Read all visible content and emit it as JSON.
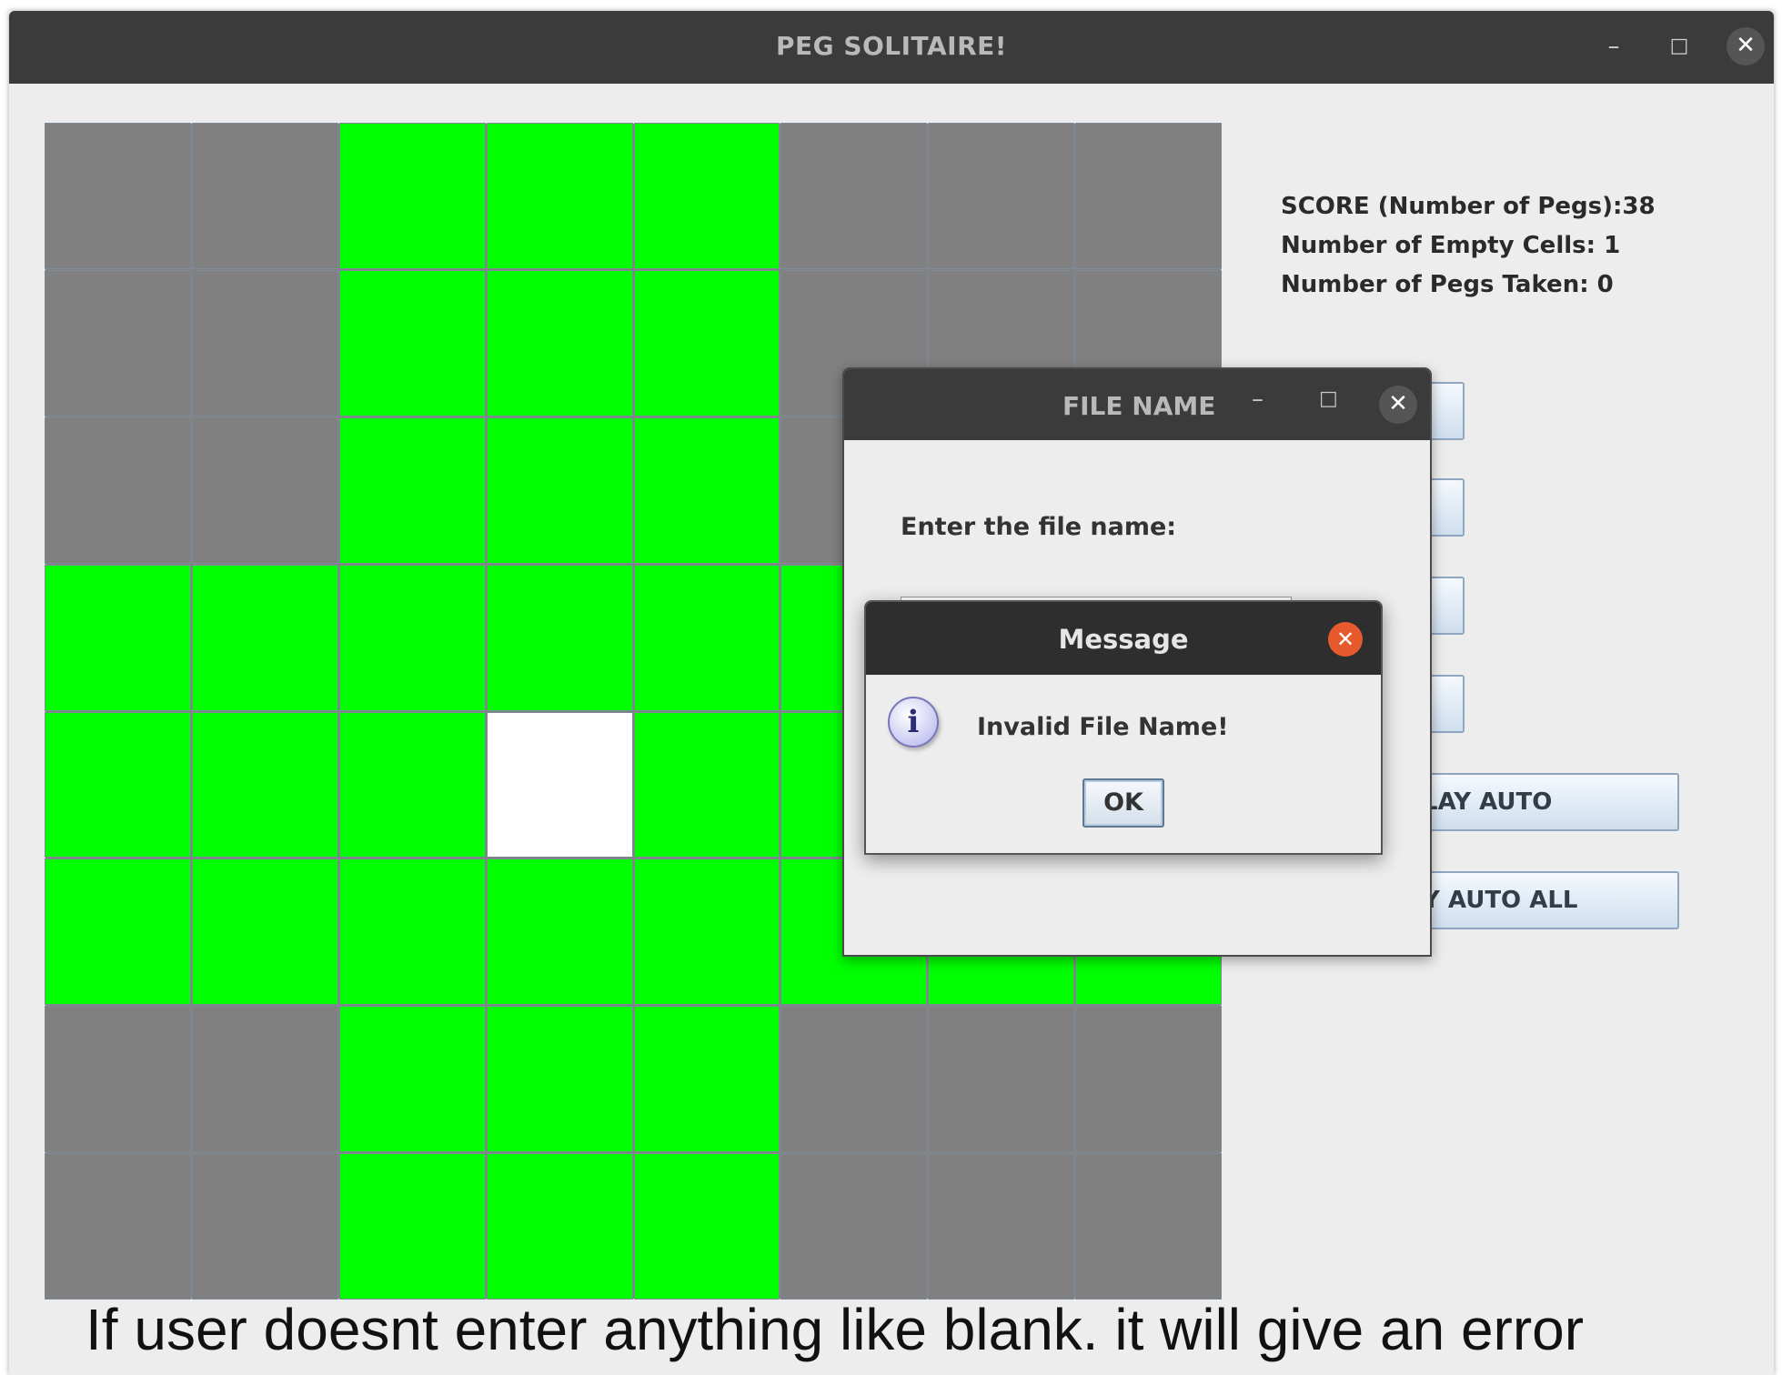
{
  "window": {
    "title": "PEG SOLITAIRE!",
    "minimize": "–",
    "maximize": "□",
    "close": "✕"
  },
  "board": {
    "rows": [
      [
        "blocked",
        "blocked",
        "peg",
        "peg",
        "peg",
        "blocked",
        "blocked",
        "blocked"
      ],
      [
        "blocked",
        "blocked",
        "peg",
        "peg",
        "peg",
        "blocked",
        "blocked",
        "blocked"
      ],
      [
        "blocked",
        "blocked",
        "peg",
        "peg",
        "peg",
        "blocked",
        "blocked",
        "blocked"
      ],
      [
        "peg",
        "peg",
        "peg",
        "peg",
        "peg",
        "peg",
        "peg",
        "peg"
      ],
      [
        "peg",
        "peg",
        "peg",
        "empty",
        "peg",
        "peg",
        "peg",
        "peg"
      ],
      [
        "peg",
        "peg",
        "peg",
        "peg",
        "peg",
        "peg",
        "peg",
        "peg"
      ],
      [
        "blocked",
        "blocked",
        "peg",
        "peg",
        "peg",
        "blocked",
        "blocked",
        "blocked"
      ],
      [
        "blocked",
        "blocked",
        "peg",
        "peg",
        "peg",
        "blocked",
        "blocked",
        "blocked"
      ]
    ],
    "colors": {
      "peg": "#00ff00",
      "empty": "#ffffff",
      "blocked": "#808080"
    }
  },
  "stats": {
    "score": "SCORE (Number of Pegs):38",
    "empty_cells": "Number of Empty Cells: 1",
    "pegs_taken": "Number of Pegs Taken: 0"
  },
  "side_buttons": [
    "",
    "",
    "",
    "",
    "LAY AUTO",
    "Y AUTO ALL"
  ],
  "file_dialog": {
    "title": "FILE NAME",
    "minimize": "–",
    "maximize": "□",
    "close": "✕",
    "prompt": "Enter the file name:",
    "field_value": ""
  },
  "message_dialog": {
    "title": "Message",
    "close": "✕",
    "icon": "info-icon",
    "icon_glyph": "i",
    "text": "Invalid File Name!",
    "ok_label": "OK",
    "accent": "#e65a2e"
  },
  "caption": "If user doesnt enter anything like blank. it will give an error"
}
